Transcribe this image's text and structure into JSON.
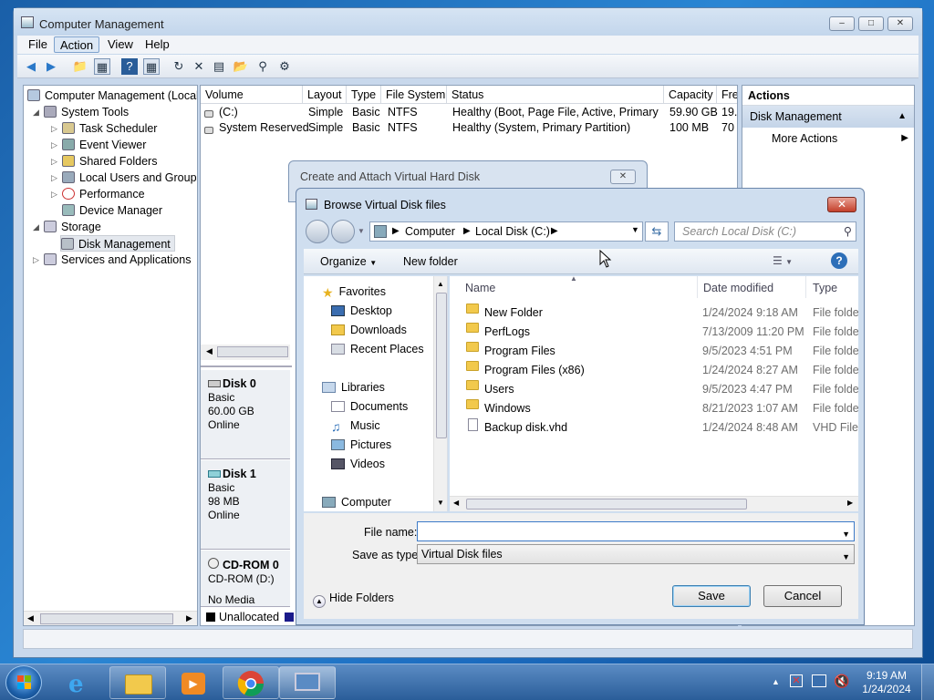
{
  "window": {
    "title": "Computer Management",
    "min": "–",
    "max": "□",
    "close": "✕"
  },
  "menu": [
    "File",
    "Action",
    "View",
    "Help"
  ],
  "toolbar_icons": [
    "back-icon",
    "forward-icon",
    "up-folder-icon",
    "show-hide-tree-icon",
    "help-icon",
    "show-hide-action-icon",
    "refresh-icon",
    "delete-icon",
    "properties-icon",
    "open-icon",
    "search-icon",
    "settings-icon"
  ],
  "tree": {
    "root": "Computer Management (Local",
    "items": [
      {
        "label": "System Tools",
        "level": 1,
        "expanded": true
      },
      {
        "label": "Task Scheduler",
        "level": 2
      },
      {
        "label": "Event Viewer",
        "level": 2
      },
      {
        "label": "Shared Folders",
        "level": 2
      },
      {
        "label": "Local Users and Groups",
        "level": 2
      },
      {
        "label": "Performance",
        "level": 2
      },
      {
        "label": "Device Manager",
        "level": 2
      },
      {
        "label": "Storage",
        "level": 1,
        "expanded": true
      },
      {
        "label": "Disk Management",
        "level": 2,
        "selected": true
      },
      {
        "label": "Services and Applications",
        "level": 1
      }
    ]
  },
  "volumes": {
    "columns": [
      "Volume",
      "Layout",
      "Type",
      "File System",
      "Status",
      "Capacity",
      "Fre"
    ],
    "rows": [
      [
        "(C:)",
        "Simple",
        "Basic",
        "NTFS",
        "Healthy (Boot, Page File, Active, Primary ...",
        "59.90 GB",
        "19."
      ],
      [
        "System Reserved",
        "Simple",
        "Basic",
        "NTFS",
        "Healthy (System, Primary Partition)",
        "100 MB",
        "70"
      ]
    ]
  },
  "disks": [
    {
      "name": "Disk 0",
      "type": "Basic",
      "size": "60.00 GB",
      "status": "Online"
    },
    {
      "name": "Disk 1",
      "type": "Basic",
      "size": "98 MB",
      "status": "Online"
    },
    {
      "name": "CD-ROM 0",
      "type": "CD-ROM (D:)",
      "size": "",
      "status": "No Media"
    }
  ],
  "legend": {
    "unallocated": "Unallocated"
  },
  "actions": {
    "header": "Actions",
    "section": "Disk Management",
    "more": "More Actions"
  },
  "cav_dialog": {
    "title": "Create and Attach Virtual Hard Disk"
  },
  "browse": {
    "title": "Browse Virtual Disk files",
    "breadcrumb": [
      "Computer",
      "Local Disk (C:)"
    ],
    "search_placeholder": "Search Local Disk (C:)",
    "organize": "Organize",
    "new_folder": "New folder",
    "nav": {
      "favorites": "Favorites",
      "favorites_items": [
        "Desktop",
        "Downloads",
        "Recent Places"
      ],
      "libraries": "Libraries",
      "libraries_items": [
        "Documents",
        "Music",
        "Pictures",
        "Videos"
      ],
      "computer": "Computer"
    },
    "headers": {
      "name": "Name",
      "date": "Date modified",
      "type": "Type"
    },
    "files": [
      {
        "name": "New Folder",
        "date": "1/24/2024 9:18 AM",
        "type": "File folder",
        "kind": "folder"
      },
      {
        "name": "PerfLogs",
        "date": "7/13/2009 11:20 PM",
        "type": "File folder",
        "kind": "folder"
      },
      {
        "name": "Program Files",
        "date": "9/5/2023 4:51 PM",
        "type": "File folder",
        "kind": "folder"
      },
      {
        "name": "Program Files (x86)",
        "date": "1/24/2024 8:27 AM",
        "type": "File folder",
        "kind": "folder"
      },
      {
        "name": "Users",
        "date": "9/5/2023 4:47 PM",
        "type": "File folder",
        "kind": "folder"
      },
      {
        "name": "Windows",
        "date": "8/21/2023 1:07 AM",
        "type": "File folder",
        "kind": "folder"
      },
      {
        "name": "Backup disk.vhd",
        "date": "1/24/2024 8:48 AM",
        "type": "VHD File",
        "kind": "vhd"
      }
    ],
    "file_name_label": "File name:",
    "file_name_value": "",
    "save_type_label": "Save as type:",
    "save_type_value": "Virtual Disk files",
    "hide_folders": "Hide Folders",
    "save": "Save",
    "cancel": "Cancel"
  },
  "clock": {
    "time": "9:19 AM",
    "date": "1/24/2024"
  }
}
